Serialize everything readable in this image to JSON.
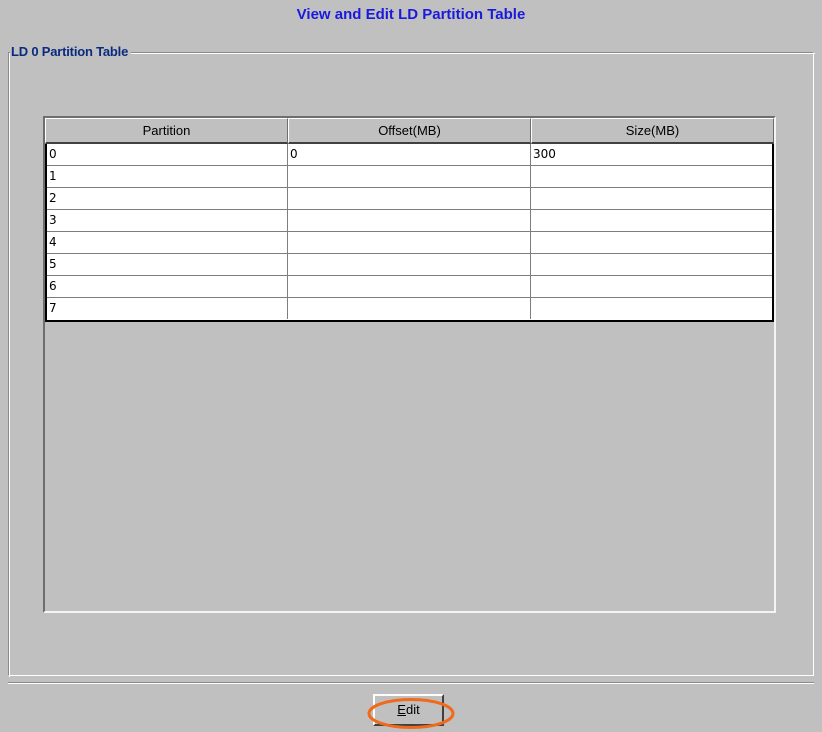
{
  "page": {
    "title": "View and Edit LD Partition Table"
  },
  "group": {
    "title": "LD 0 Partition Table"
  },
  "table": {
    "columns": [
      "Partition",
      "Offset(MB)",
      "Size(MB)"
    ],
    "rows": [
      [
        "0",
        "0",
        "300"
      ],
      [
        "1",
        "",
        ""
      ],
      [
        "2",
        "",
        ""
      ],
      [
        "3",
        "",
        ""
      ],
      [
        "4",
        "",
        ""
      ],
      [
        "5",
        "",
        ""
      ],
      [
        "6",
        "",
        ""
      ],
      [
        "7",
        "",
        ""
      ]
    ]
  },
  "buttons": {
    "edit_mnemonic": "E",
    "edit_rest": "dit"
  },
  "colors": {
    "title": "#1a1adc",
    "group_title": "#0a2a80",
    "background": "#c0c0c0",
    "highlight": "#f06a1a"
  }
}
